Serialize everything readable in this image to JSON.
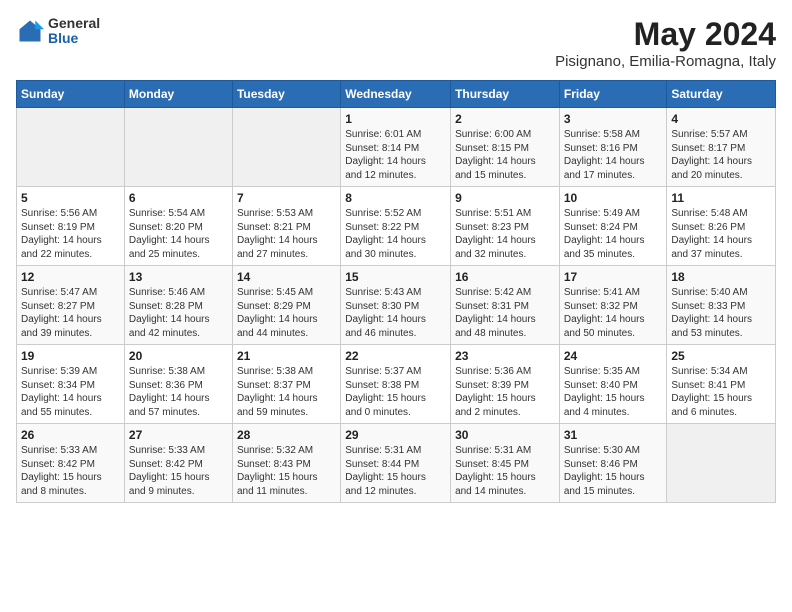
{
  "header": {
    "logo_general": "General",
    "logo_blue": "Blue",
    "month": "May 2024",
    "location": "Pisignano, Emilia-Romagna, Italy"
  },
  "days_of_week": [
    "Sunday",
    "Monday",
    "Tuesday",
    "Wednesday",
    "Thursday",
    "Friday",
    "Saturday"
  ],
  "weeks": [
    [
      {
        "day": "",
        "info": ""
      },
      {
        "day": "",
        "info": ""
      },
      {
        "day": "",
        "info": ""
      },
      {
        "day": "1",
        "info": "Sunrise: 6:01 AM\nSunset: 8:14 PM\nDaylight: 14 hours\nand 12 minutes."
      },
      {
        "day": "2",
        "info": "Sunrise: 6:00 AM\nSunset: 8:15 PM\nDaylight: 14 hours\nand 15 minutes."
      },
      {
        "day": "3",
        "info": "Sunrise: 5:58 AM\nSunset: 8:16 PM\nDaylight: 14 hours\nand 17 minutes."
      },
      {
        "day": "4",
        "info": "Sunrise: 5:57 AM\nSunset: 8:17 PM\nDaylight: 14 hours\nand 20 minutes."
      }
    ],
    [
      {
        "day": "5",
        "info": "Sunrise: 5:56 AM\nSunset: 8:19 PM\nDaylight: 14 hours\nand 22 minutes."
      },
      {
        "day": "6",
        "info": "Sunrise: 5:54 AM\nSunset: 8:20 PM\nDaylight: 14 hours\nand 25 minutes."
      },
      {
        "day": "7",
        "info": "Sunrise: 5:53 AM\nSunset: 8:21 PM\nDaylight: 14 hours\nand 27 minutes."
      },
      {
        "day": "8",
        "info": "Sunrise: 5:52 AM\nSunset: 8:22 PM\nDaylight: 14 hours\nand 30 minutes."
      },
      {
        "day": "9",
        "info": "Sunrise: 5:51 AM\nSunset: 8:23 PM\nDaylight: 14 hours\nand 32 minutes."
      },
      {
        "day": "10",
        "info": "Sunrise: 5:49 AM\nSunset: 8:24 PM\nDaylight: 14 hours\nand 35 minutes."
      },
      {
        "day": "11",
        "info": "Sunrise: 5:48 AM\nSunset: 8:26 PM\nDaylight: 14 hours\nand 37 minutes."
      }
    ],
    [
      {
        "day": "12",
        "info": "Sunrise: 5:47 AM\nSunset: 8:27 PM\nDaylight: 14 hours\nand 39 minutes."
      },
      {
        "day": "13",
        "info": "Sunrise: 5:46 AM\nSunset: 8:28 PM\nDaylight: 14 hours\nand 42 minutes."
      },
      {
        "day": "14",
        "info": "Sunrise: 5:45 AM\nSunset: 8:29 PM\nDaylight: 14 hours\nand 44 minutes."
      },
      {
        "day": "15",
        "info": "Sunrise: 5:43 AM\nSunset: 8:30 PM\nDaylight: 14 hours\nand 46 minutes."
      },
      {
        "day": "16",
        "info": "Sunrise: 5:42 AM\nSunset: 8:31 PM\nDaylight: 14 hours\nand 48 minutes."
      },
      {
        "day": "17",
        "info": "Sunrise: 5:41 AM\nSunset: 8:32 PM\nDaylight: 14 hours\nand 50 minutes."
      },
      {
        "day": "18",
        "info": "Sunrise: 5:40 AM\nSunset: 8:33 PM\nDaylight: 14 hours\nand 53 minutes."
      }
    ],
    [
      {
        "day": "19",
        "info": "Sunrise: 5:39 AM\nSunset: 8:34 PM\nDaylight: 14 hours\nand 55 minutes."
      },
      {
        "day": "20",
        "info": "Sunrise: 5:38 AM\nSunset: 8:36 PM\nDaylight: 14 hours\nand 57 minutes."
      },
      {
        "day": "21",
        "info": "Sunrise: 5:38 AM\nSunset: 8:37 PM\nDaylight: 14 hours\nand 59 minutes."
      },
      {
        "day": "22",
        "info": "Sunrise: 5:37 AM\nSunset: 8:38 PM\nDaylight: 15 hours\nand 0 minutes."
      },
      {
        "day": "23",
        "info": "Sunrise: 5:36 AM\nSunset: 8:39 PM\nDaylight: 15 hours\nand 2 minutes."
      },
      {
        "day": "24",
        "info": "Sunrise: 5:35 AM\nSunset: 8:40 PM\nDaylight: 15 hours\nand 4 minutes."
      },
      {
        "day": "25",
        "info": "Sunrise: 5:34 AM\nSunset: 8:41 PM\nDaylight: 15 hours\nand 6 minutes."
      }
    ],
    [
      {
        "day": "26",
        "info": "Sunrise: 5:33 AM\nSunset: 8:42 PM\nDaylight: 15 hours\nand 8 minutes."
      },
      {
        "day": "27",
        "info": "Sunrise: 5:33 AM\nSunset: 8:42 PM\nDaylight: 15 hours\nand 9 minutes."
      },
      {
        "day": "28",
        "info": "Sunrise: 5:32 AM\nSunset: 8:43 PM\nDaylight: 15 hours\nand 11 minutes."
      },
      {
        "day": "29",
        "info": "Sunrise: 5:31 AM\nSunset: 8:44 PM\nDaylight: 15 hours\nand 12 minutes."
      },
      {
        "day": "30",
        "info": "Sunrise: 5:31 AM\nSunset: 8:45 PM\nDaylight: 15 hours\nand 14 minutes."
      },
      {
        "day": "31",
        "info": "Sunrise: 5:30 AM\nSunset: 8:46 PM\nDaylight: 15 hours\nand 15 minutes."
      },
      {
        "day": "",
        "info": ""
      }
    ]
  ]
}
